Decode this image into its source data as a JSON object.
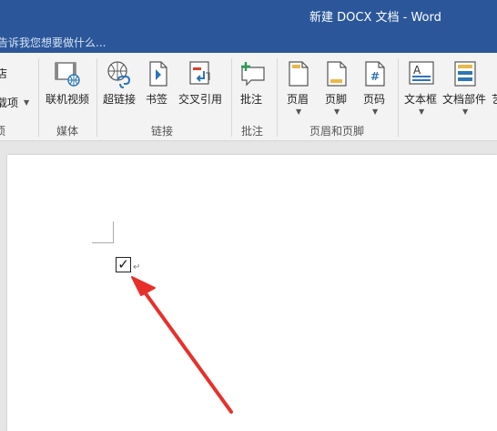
{
  "window": {
    "title": "新建 DOCX 文档 - Word"
  },
  "tell_me": {
    "placeholder": "告诉我您想要做什么..."
  },
  "ribbon": {
    "left_partial": {
      "item1": "店",
      "item2": "载项"
    },
    "left_group_partial": "项",
    "buttons": {
      "online_video": "联机视频",
      "hyperlink": "超链接",
      "bookmark": "书签",
      "cross_reference": "交叉引用",
      "comment": "批注",
      "header": "页眉",
      "footer": "页脚",
      "page_number": "页码",
      "text_box": "文本框",
      "quick_parts": "文档部件",
      "cut_off": "艺"
    },
    "groups": {
      "media": "媒体",
      "links": "链接",
      "comments": "批注",
      "header_footer": "页眉和页脚"
    }
  },
  "document": {
    "checkbox_symbol": "✓",
    "paragraph_mark": "↵",
    "annotation_color": "#e8302b"
  },
  "colors": {
    "accent": "#2b579a"
  }
}
